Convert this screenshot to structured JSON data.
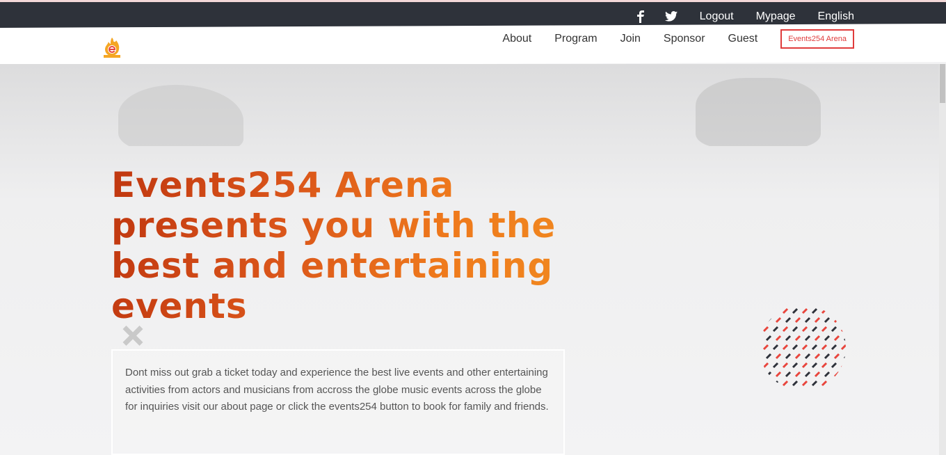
{
  "topbar": {
    "facebook_icon": "facebook-icon",
    "twitter_icon": "twitter-icon",
    "logout_label": "Logout",
    "mypage_label": "Mypage",
    "language_label": "English"
  },
  "nav": {
    "logo_icon": "events254-logo",
    "links": [
      {
        "label": "About"
      },
      {
        "label": "Program"
      },
      {
        "label": "Join"
      },
      {
        "label": "Sponsor"
      },
      {
        "label": "Guest"
      }
    ],
    "cta_label": "Events254 Arena"
  },
  "hero": {
    "headline_lines": [
      "Events254 Arena",
      "presents you with the",
      "best and entertaining",
      "events"
    ],
    "description": "Dont miss out grab a ticket today and experience the best live events and other entertaining activities from actors and musicians from accross the globe music events across the globe for inquiries visit our about page or click the events254 button to book for family and friends."
  },
  "colors": {
    "topbar_bg": "#2e323a",
    "accent_red": "#e03b3b",
    "headline_orange": "#ef7a1c",
    "headline_red": "#c0370f",
    "pattern_dark": "#2e323a",
    "pattern_red": "#e8453c"
  }
}
